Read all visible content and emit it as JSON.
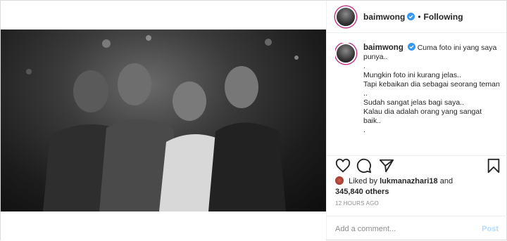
{
  "header": {
    "username": "baimwong",
    "separator": "•",
    "follow_status": "Following"
  },
  "caption": {
    "username": "baimwong",
    "lines": [
      "Cuma foto ini yang saya punya..",
      ".",
      "Mungkin foto ini kurang jelas..",
      "Tapi kebaikan dia sebagai seorang teman ..",
      "Sudah sangat jelas bagi saya..",
      "Kalau dia adalah orang yang sangat baik..",
      "."
    ]
  },
  "likes": {
    "prefix": "Liked by",
    "liker": "lukmanazhari18",
    "and": "and",
    "count": "345,840 others"
  },
  "timestamp": "12 HOURS AGO",
  "comment_box": {
    "placeholder": "Add a comment...",
    "post_label": "Post"
  },
  "colors": {
    "verified": "#3897f0",
    "post_disabled": "#b3dbff",
    "story_ring": "#c13584"
  },
  "icons": [
    "heart-icon",
    "comment-icon",
    "share-icon",
    "bookmark-icon",
    "verified-badge-icon"
  ]
}
